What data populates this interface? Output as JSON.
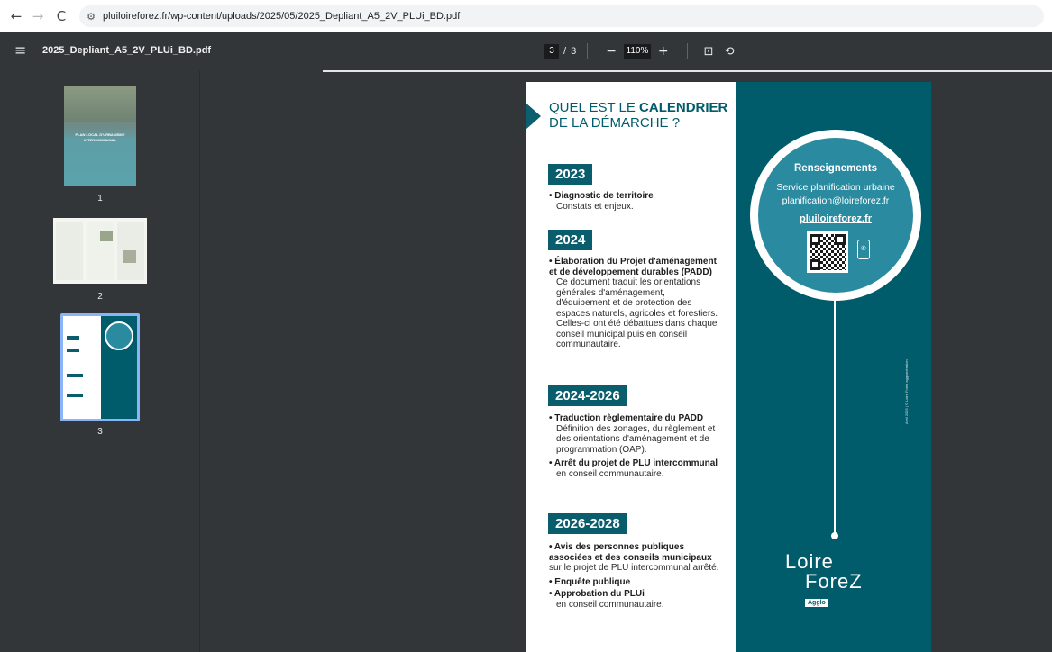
{
  "browser": {
    "back_icon": "←",
    "forward_icon": "→",
    "reload_icon": "C",
    "site_info_icon": "⚙",
    "url": "pluiloireforez.fr/wp-content/uploads/2025/05/2025_Depliant_A5_2V_PLUi_BD.pdf"
  },
  "toolbar": {
    "menu_icon": "≡",
    "title": "2025_Depliant_A5_2V_PLUi_BD.pdf",
    "current_page": "3",
    "page_separator": "/",
    "total_pages": "3",
    "zoom_out": "−",
    "zoom_level": "110%",
    "zoom_in": "+",
    "fit_icon": "⊡",
    "rotate_icon": "⟲"
  },
  "sidebar": {
    "thumbnails": [
      {
        "label": "1",
        "band_text": "PLAN LOCAL D'URBANISME INTERCOMMUNAL"
      },
      {
        "label": "2"
      },
      {
        "label": "3"
      }
    ]
  },
  "page": {
    "heading_line1_prefix": "QUEL EST LE ",
    "heading_line1_bold": "CALENDRIER",
    "heading_line2": "DE LA DÉMARCHE ?",
    "sections": [
      {
        "year": "2023",
        "items": [
          {
            "title": "• Diagnostic de territoire",
            "desc": "Constats et enjeux."
          }
        ]
      },
      {
        "year": "2024",
        "items": [
          {
            "title": "• Élaboration du Projet d'aménagement et de développement durables (PADD)",
            "desc": "Ce document traduit les orientations générales d'aménagement, d'équipement et de protection des espaces naturels, agricoles et forestiers. Celles-ci ont  été débattues dans chaque conseil municipal puis en conseil communautaire."
          }
        ]
      },
      {
        "year": "2024-2026",
        "items": [
          {
            "title": "• Traduction règlementaire du PADD",
            "desc": "Définition des zonages, du règlement et des orientations d'aménagement et de programmation (OAP)."
          },
          {
            "title": "• Arrêt du projet de PLU intercommunal",
            "desc": "en conseil communautaire."
          }
        ]
      },
      {
        "year": "2026-2028",
        "items": [
          {
            "title": "• Avis des personnes publiques associées et des conseils municipaux",
            "desc": " sur le projet de PLU intercommunal arrêté."
          },
          {
            "title": "• Enquête publique",
            "desc": ""
          },
          {
            "title": "• Approbation du PLUi",
            "desc": "en conseil communautaire."
          }
        ]
      }
    ],
    "info": {
      "title": "Renseignements",
      "line1": "Service planification urbaine",
      "line2": "planification@loireforez.fr",
      "url": "pluiloireforez.fr",
      "phone_icon": "✆"
    },
    "side_credit": "Avril 2025 | © Loire Forez agglomération",
    "logo": {
      "line1": "Loire",
      "line2": "ForeZ",
      "agglo": "Agglo"
    }
  },
  "colors": {
    "teal_dark": "#005b6b",
    "teal_circle": "#2a8aa0",
    "viewer_bg": "#323639",
    "thumb_selected_border": "#8ab4f8"
  }
}
